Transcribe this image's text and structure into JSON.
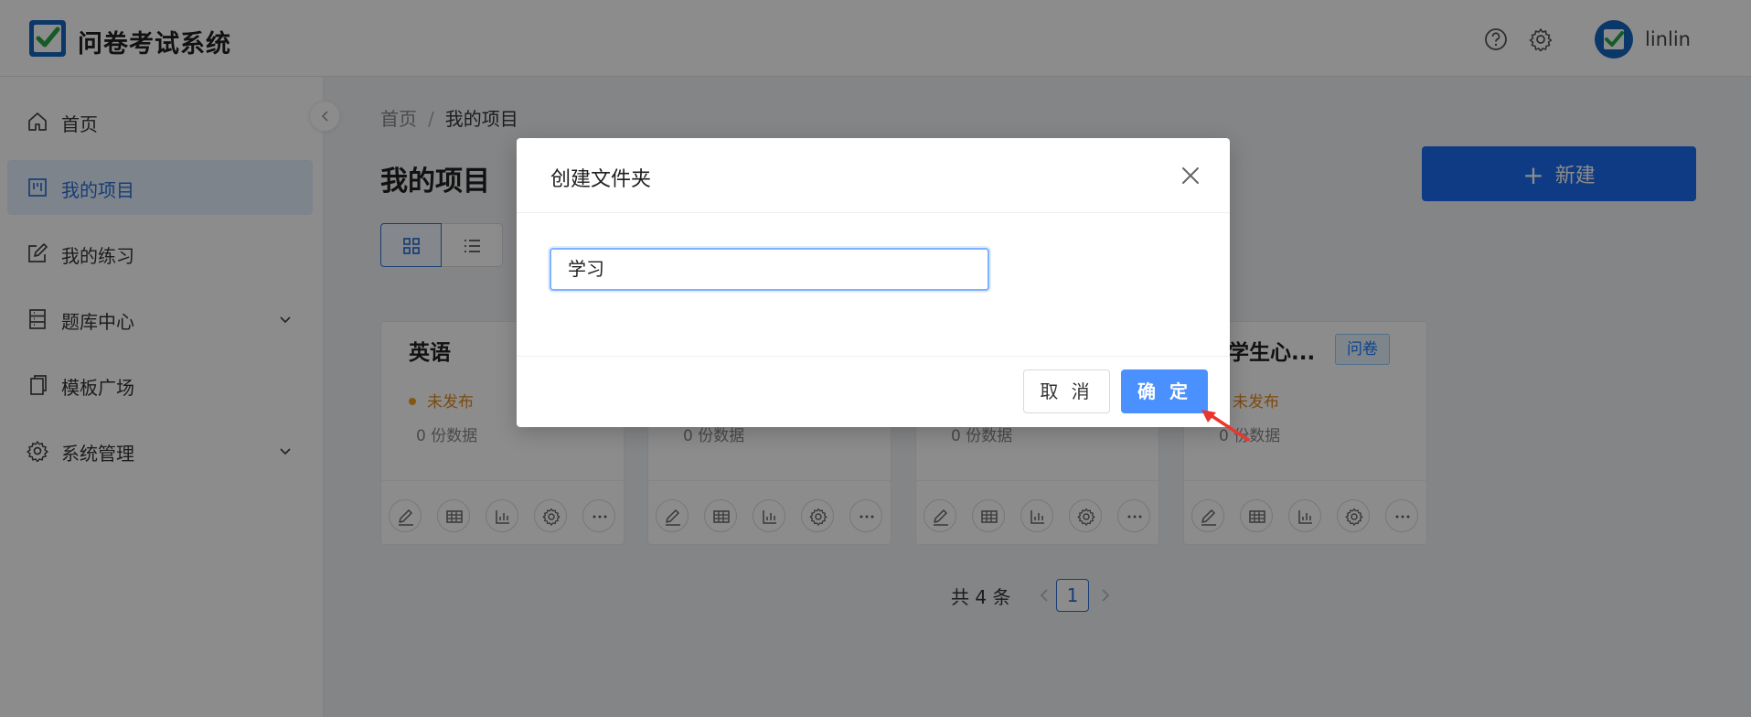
{
  "app": {
    "title": "问卷考试系统",
    "username": "linlin"
  },
  "header": {
    "help_icon": "help-circle-icon",
    "settings_icon": "gear-icon"
  },
  "sidebar": {
    "items": [
      {
        "label": "首页",
        "icon": "home-icon"
      },
      {
        "label": "我的项目",
        "icon": "project-icon",
        "active": true
      },
      {
        "label": "我的练习",
        "icon": "edit-icon"
      },
      {
        "label": "题库中心",
        "icon": "database-icon",
        "expandable": true
      },
      {
        "label": "模板广场",
        "icon": "copy-icon"
      },
      {
        "label": "系统管理",
        "icon": "gear-icon",
        "expandable": true
      }
    ]
  },
  "breadcrumb": {
    "home": "首页",
    "separator": "/",
    "current": "我的项目"
  },
  "main": {
    "title": "我的项目",
    "new_button": "新建",
    "new_button_prefix": "+"
  },
  "cards": [
    {
      "title": "英语",
      "tag": "",
      "status": "未发布",
      "count": "0  份数据"
    },
    {
      "title": "",
      "tag": "",
      "status": "",
      "count": "0  份数据"
    },
    {
      "title": "",
      "tag": "",
      "status": "",
      "count": "0  份数据"
    },
    {
      "title": "学生心...",
      "tag": "问卷",
      "status": "未发布",
      "count": "0  份数据"
    }
  ],
  "pagination": {
    "total_text": "共 4 条",
    "current_page": "1"
  },
  "modal": {
    "title": "创建文件夹",
    "input_value": "学习",
    "cancel_label": "取 消",
    "ok_label": "确 定"
  },
  "colors": {
    "primary": "#1a6cf0",
    "warning": "#e0891b",
    "ok_button": "#4a90ff",
    "arrow": "#e8372e"
  }
}
